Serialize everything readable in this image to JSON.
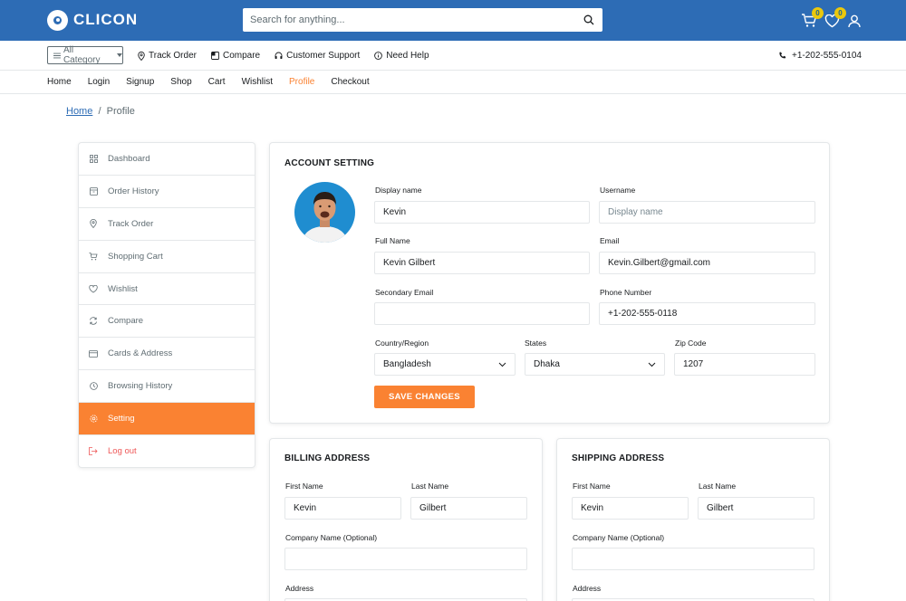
{
  "header": {
    "logo_text": "CLICON",
    "search_placeholder": "Search for anything...",
    "cart_count": "0",
    "wishlist_count": "0"
  },
  "subbar": {
    "category_label": "All Category",
    "items": [
      "Track Order",
      "Compare",
      "Customer Support",
      "Need Help"
    ],
    "phone": "+1-202-555-0104"
  },
  "nav": [
    "Home",
    "Login",
    "Signup",
    "Shop",
    "Cart",
    "Wishlist",
    "Profile",
    "Checkout"
  ],
  "breadcrumb": {
    "home": "Home",
    "current": "Profile"
  },
  "sidebar": [
    "Dashboard",
    "Order History",
    "Track Order",
    "Shopping Cart",
    "Wishlist",
    "Compare",
    "Cards & Address",
    "Browsing History",
    "Setting",
    "Log out"
  ],
  "account": {
    "title": "ACCOUNT SETTING",
    "display_name_label": "Display name",
    "display_name": "Kevin",
    "username_label": "Username",
    "username_placeholder": "Display name",
    "full_name_label": "Full Name",
    "full_name": "Kevin Gilbert",
    "email_label": "Email",
    "email": "Kevin.Gilbert@gmail.com",
    "secondary_email_label": "Secondary Email",
    "secondary_email": "",
    "phone_label": "Phone Number",
    "phone": "+1-202-555-0118",
    "country_label": "Country/Region",
    "country": "Bangladesh",
    "states_label": "States",
    "state": "Dhaka",
    "zip_label": "Zip Code",
    "zip": "1207",
    "save_label": "SAVE CHANGES"
  },
  "billing": {
    "title": "BILLING ADDRESS",
    "first_name_label": "First Name",
    "first_name": "Kevin",
    "last_name_label": "Last Name",
    "last_name": "Gilbert",
    "company_label": "Company Name (Optional)",
    "address_label": "Address"
  },
  "shipping": {
    "title": "SHIPPING ADDRESS",
    "first_name_label": "First Name",
    "first_name": "Kevin",
    "last_name_label": "Last Name",
    "last_name": "Gilbert",
    "company_label": "Company Name (Optional)",
    "address_label": "Address"
  }
}
